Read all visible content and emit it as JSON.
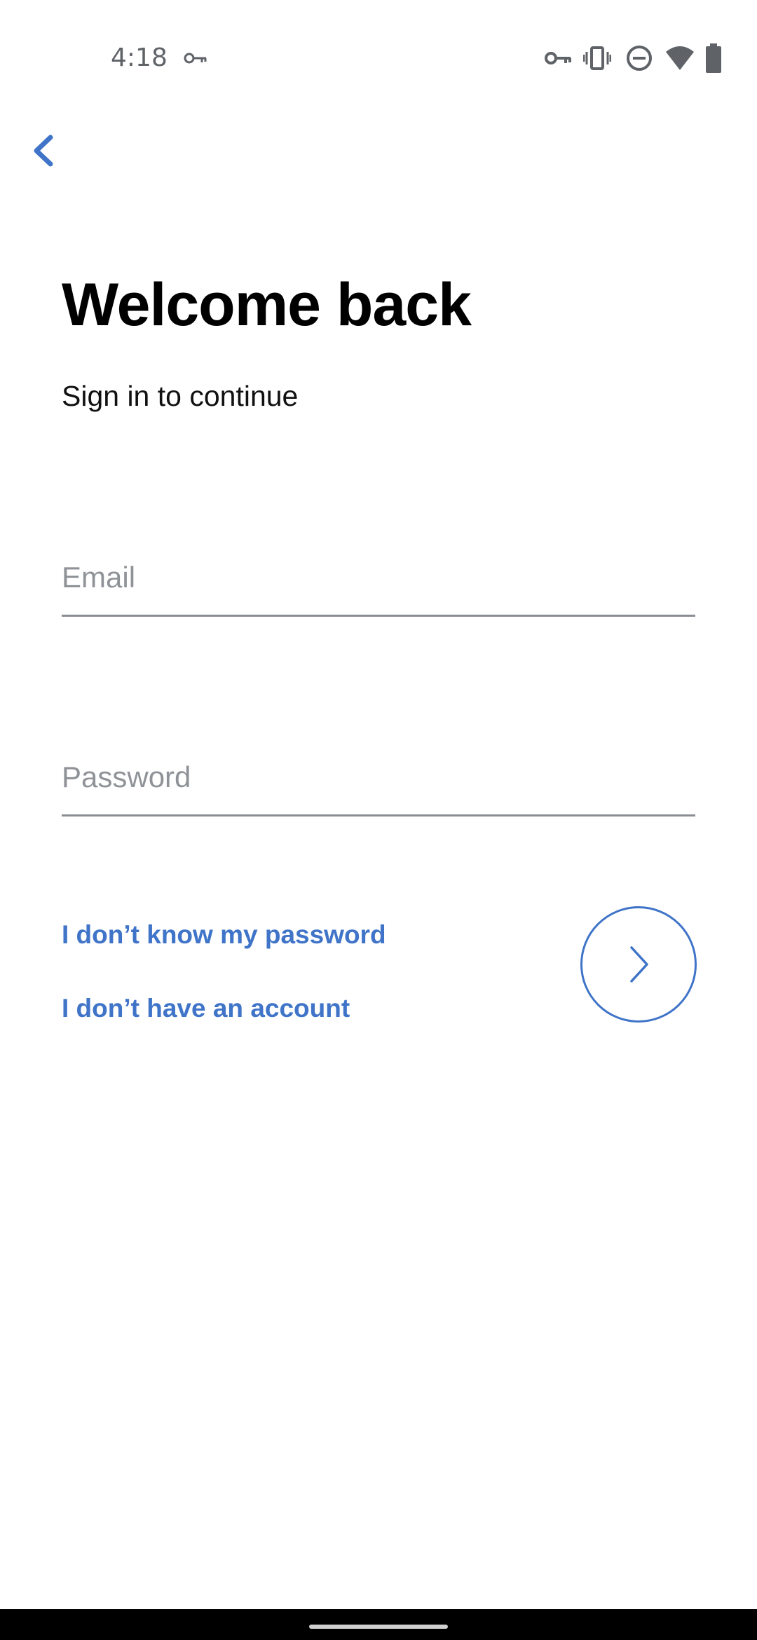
{
  "status_bar": {
    "time": "4:18",
    "icons": [
      "vpn-key-icon",
      "vpn-key-icon",
      "vibrate-icon",
      "do-not-disturb-icon",
      "wifi-icon",
      "battery-icon"
    ],
    "icon_color": "#5f6368"
  },
  "header": {
    "back_icon": "chevron-left-icon"
  },
  "main": {
    "title": "Welcome back",
    "subtitle": "Sign in to continue",
    "email": {
      "placeholder": "Email",
      "value": ""
    },
    "password": {
      "placeholder": "Password",
      "value": ""
    },
    "forgot_password_link": "I don’t know my password",
    "no_account_link": "I don’t have an account",
    "next_icon": "chevron-right-icon"
  },
  "colors": {
    "accent": "#3f74c8",
    "text": "#000000",
    "placeholder": "#8f9398",
    "underline": "#8a8e94",
    "background": "#ffffff"
  }
}
